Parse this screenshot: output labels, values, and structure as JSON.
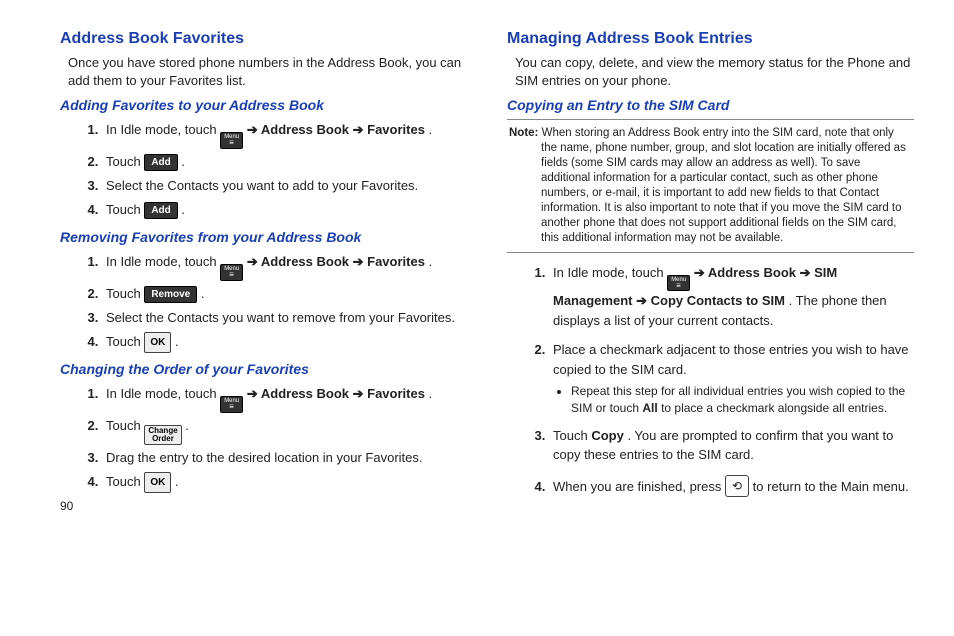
{
  "left": {
    "h1": "Address Book Favorites",
    "intro": "Once you have stored phone numbers in the Address Book, you can add them to your Favorites list.",
    "sec1": {
      "h2": "Adding Favorites to your Address Book",
      "s1a": " In Idle mode, touch ",
      "menu": "Menu",
      "s1b": " ➔ ",
      "s1c": "Address Book",
      "s1d": " ➔ ",
      "s1e": "Favorites",
      "s1f": ".",
      "s2a": "Touch ",
      "add": "Add",
      "s2b": ".",
      "s3": "Select the Contacts you want to add to your Favorites.",
      "s4a": "Touch ",
      "s4b": "."
    },
    "sec2": {
      "h2": "Removing Favorites from your Address Book",
      "s1a": " In Idle mode, touch ",
      "s2a": "Touch ",
      "remove": "Remove",
      "s2b": ".",
      "s3": "Select the Contacts you want to remove from your Favorites.",
      "s4a": "Touch ",
      "ok": "OK",
      "s4b": " ."
    },
    "sec3": {
      "h2": "Changing the Order of your Favorites",
      "s1a": " In Idle mode, touch ",
      "s2a": "Touch ",
      "co1": "Change",
      "co2": "Order",
      "s2b": " .",
      "s3": "Drag the entry to the desired location in your Favorites.",
      "s4a": "Touch ",
      "s4b": " ."
    },
    "page": "90"
  },
  "right": {
    "h1": "Managing Address Book Entries",
    "intro": "You can copy, delete, and view the memory status for the Phone and SIM entries on your phone.",
    "sec1": {
      "h2": "Copying an Entry to the SIM Card",
      "noteLabel": "Note:",
      "note": " When storing an Address Book entry into the SIM card, note that only the name, phone number, group, and slot location are initially offered as fields (some SIM cards may allow an address as well). To save additional information for a particular contact, such as other phone numbers, or e-mail, it is important to add new fields to that Contact information. It is also important to note that if you move the SIM card to another phone that does not support additional fields on the SIM card, this additional information may not be available.",
      "s1a": "In Idle mode, touch ",
      "menu": "Menu",
      "s1b": " ➔ ",
      "s1c": "Address Book",
      "s1d": " ➔ ",
      "s1e": "SIM Management",
      "s1f": " ➔ ",
      "s1g": "Copy Contacts to SIM",
      "s1h": ". The phone then displays a list of your current contacts.",
      "s2": "Place a checkmark adjacent to those entries you wish to have copied to the SIM card.",
      "bul_a": "Repeat this step for all individual entries you wish copied to the SIM or touch ",
      "bul_b": "All",
      "bul_c": " to place a checkmark alongside all entries.",
      "s3a": "Touch ",
      "s3b": "Copy",
      "s3c": ". You are prompted to confirm that you want to copy these entries to the SIM card.",
      "s4a": "When you are finished, press ",
      "ret": "⟲",
      "s4b": " to return to the Main menu."
    }
  }
}
